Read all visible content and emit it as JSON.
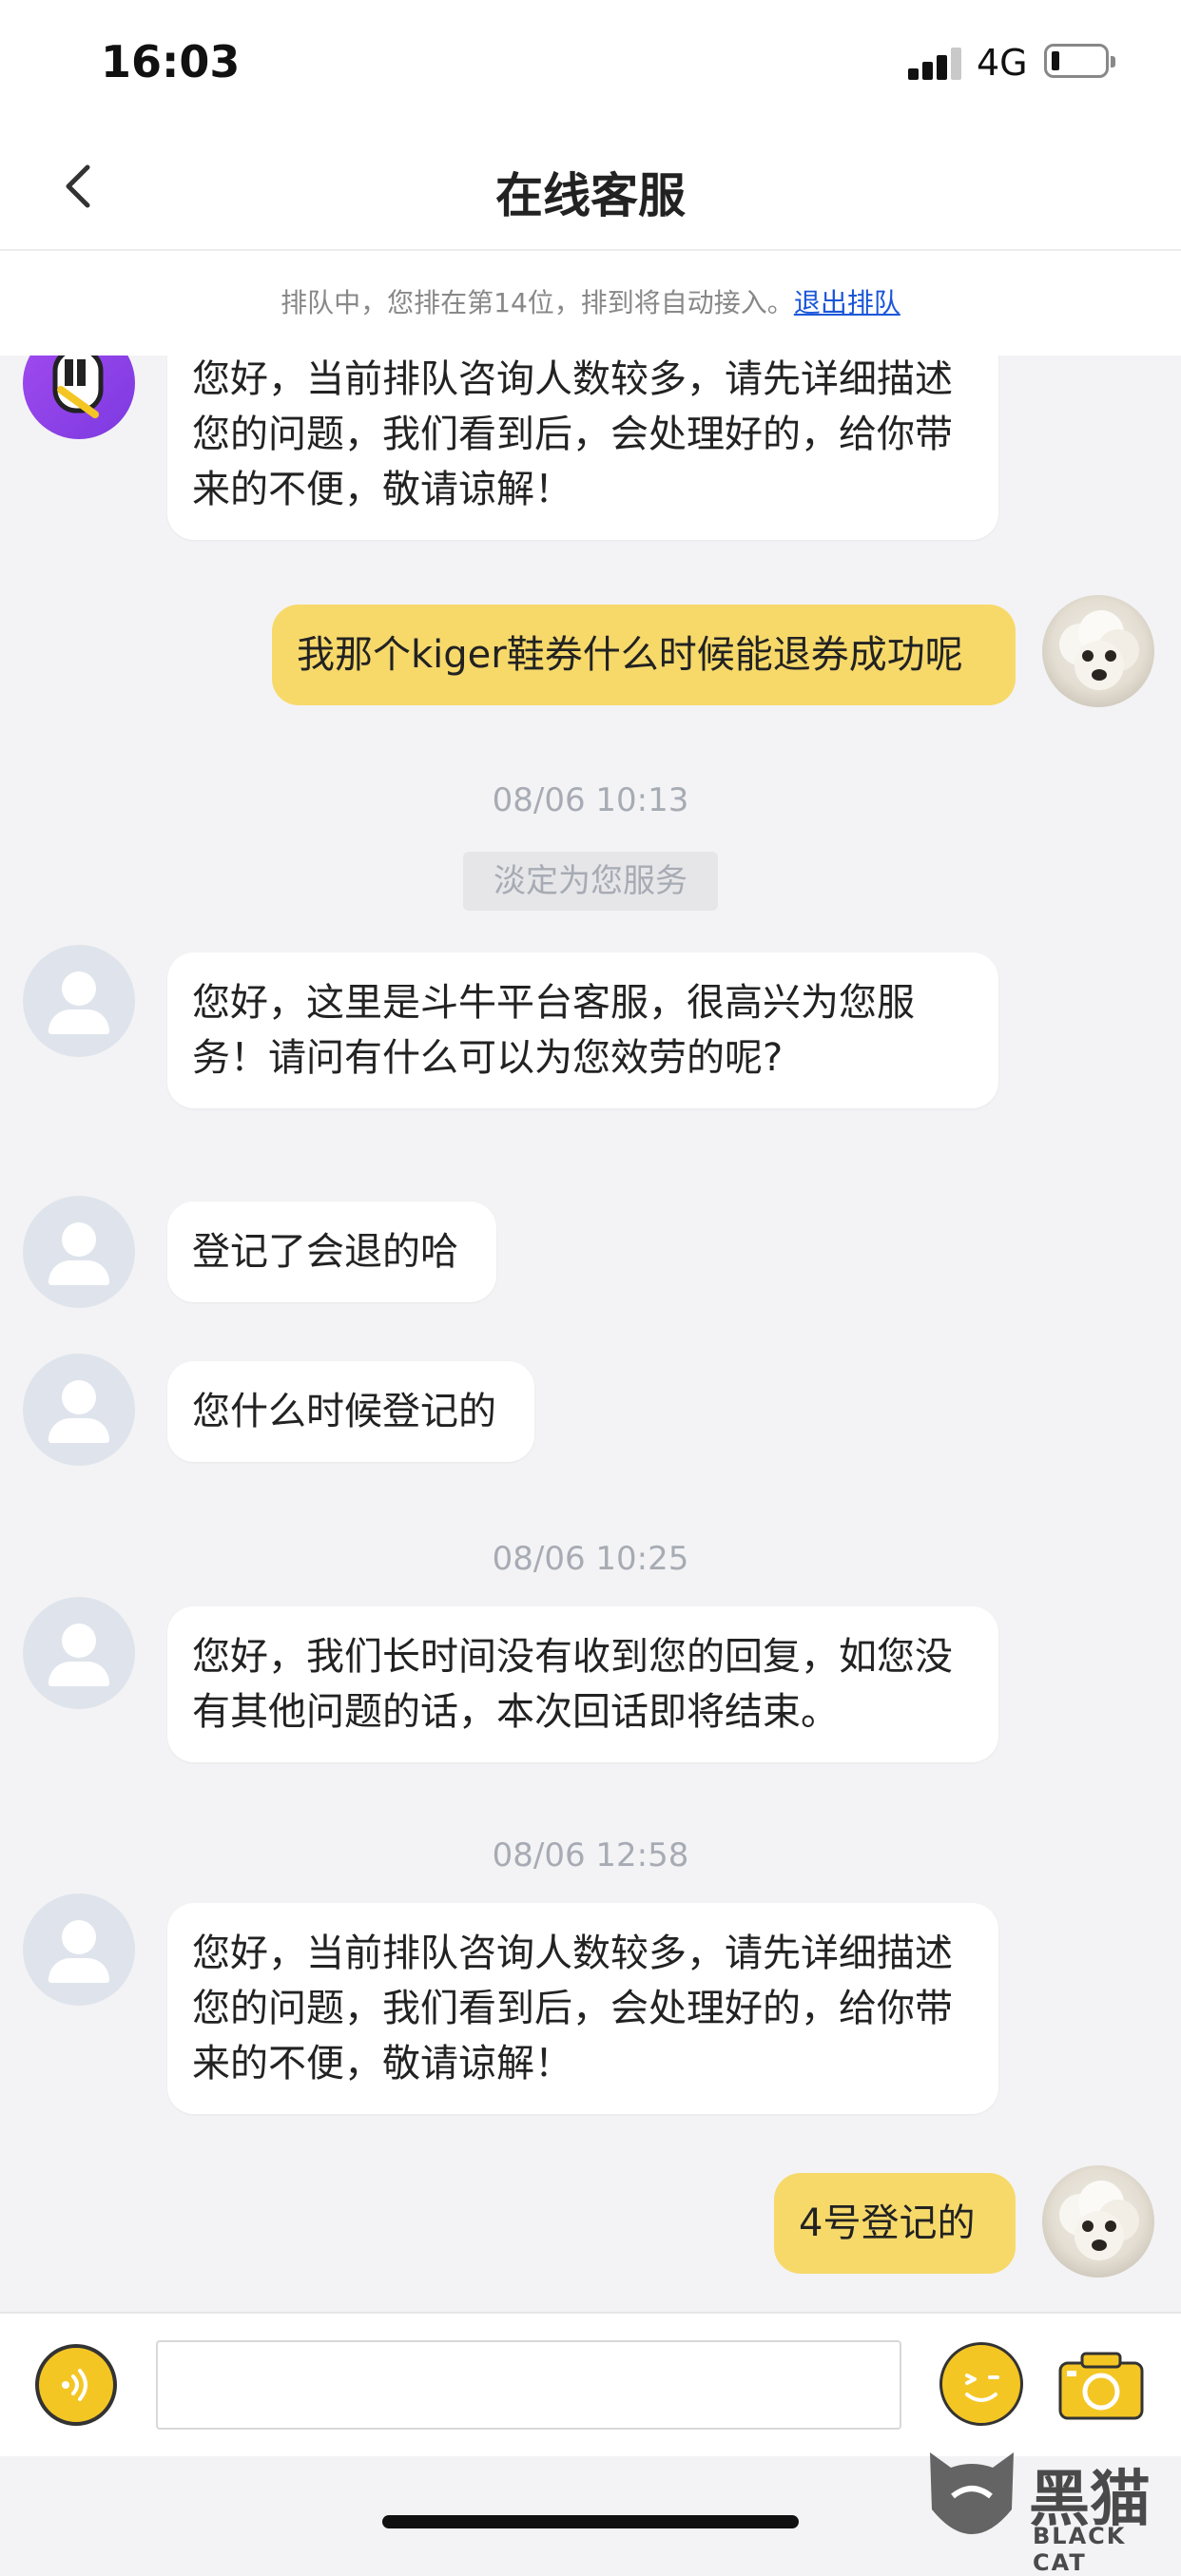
{
  "status_bar": {
    "time": "16:03",
    "network": "4G",
    "battery_level": 0.15
  },
  "header": {
    "title": "在线客服"
  },
  "queue_bar": {
    "text": "排队中，您排在第14位，排到将自动接入。",
    "leave_link": "退出排队"
  },
  "messages": [
    {
      "text": "您好，当前排队咨询人数较多，请先详细描述您的问题，我们看到后，会处理好的，给你带来的不便，敬请谅解！"
    },
    {
      "text": "我那个kiger鞋券什么时候能退券成功呢"
    },
    {
      "timestamp": "08/06 10:13"
    },
    {
      "system": "淡定为您服务"
    },
    {
      "text": "您好，这里是斗牛平台客服，很高兴为您服务！请问有什么可以为您效劳的呢?"
    },
    {
      "text": "登记了会退的哈"
    },
    {
      "text": "您什么时候登记的"
    },
    {
      "timestamp": "08/06 10:25"
    },
    {
      "text": "您好，我们长时间没有收到您的回复，如您没有其他问题的话，本次回话即将结束。"
    },
    {
      "timestamp": "08/06 12:58"
    },
    {
      "text": "您好，当前排队咨询人数较多，请先详细描述您的问题，我们看到后，会处理好的，给你带来的不便，敬请谅解！"
    },
    {
      "text": "4号登记的"
    }
  ],
  "input_bar": {
    "placeholder": ""
  },
  "watermark": {
    "main": "黑猫",
    "sub": "BLACK CAT"
  },
  "colors": {
    "accent": "#f4c624",
    "outgoing_bubble": "#f7d96a",
    "link": "#1b56d9"
  }
}
